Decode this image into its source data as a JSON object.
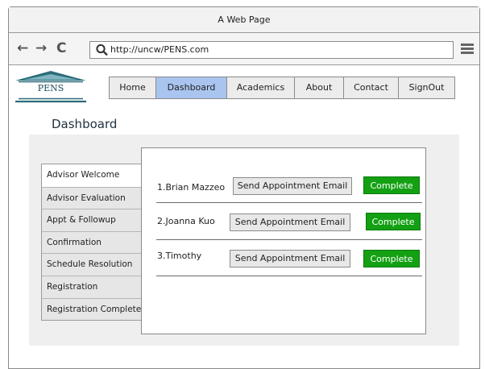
{
  "window": {
    "title": "A Web Page"
  },
  "browser": {
    "url": "http://uncw/PENS.com",
    "back": "←",
    "forward": "→",
    "reload": "C"
  },
  "logo": {
    "text": "PENS"
  },
  "nav": {
    "tabs": [
      {
        "label": "Home",
        "active": false
      },
      {
        "label": "Dashboard",
        "active": true
      },
      {
        "label": "Academics",
        "active": false
      },
      {
        "label": "About",
        "active": false
      },
      {
        "label": "Contact",
        "active": false
      },
      {
        "label": "SignOut",
        "active": false
      }
    ]
  },
  "page": {
    "title": "Dashboard"
  },
  "sidebar": {
    "items": [
      {
        "label": "Advisor Welcome",
        "active": true
      },
      {
        "label": "Advisor Evaluation",
        "active": false
      },
      {
        "label": "Appt & Followup",
        "active": false
      },
      {
        "label": "Confirmation",
        "active": false
      },
      {
        "label": "Schedule Resolution",
        "active": false
      },
      {
        "label": "Registration",
        "active": false
      },
      {
        "label": "Registration Complete",
        "active": false
      }
    ]
  },
  "students": [
    {
      "name": "1.Brian Mazzeo",
      "send_label": "Send Appointment Email",
      "complete_label": "Complete"
    },
    {
      "name": "2.Joanna Kuo",
      "send_label": "Send Appointment Email",
      "complete_label": "Complete"
    },
    {
      "name": "3.Timothy",
      "send_label": "Send Appointment Email",
      "complete_label": "Complete"
    }
  ]
}
